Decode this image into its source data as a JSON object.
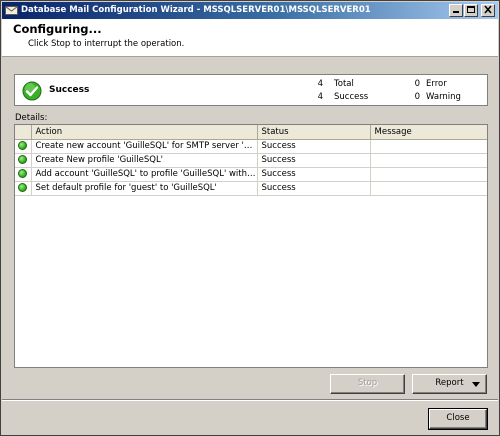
{
  "window": {
    "title": "Database Mail Configuration Wizard - MSSQLSERVER01\\MSSQLSERVER01"
  },
  "header": {
    "heading": "Configuring...",
    "subtitle": "Click Stop to interrupt the operation."
  },
  "summary": {
    "status": "Success",
    "total_count": "4",
    "total_label": "Total",
    "success_count": "4",
    "success_label": "Success",
    "error_count": "0",
    "error_label": "Error",
    "warning_count": "0",
    "warning_label": "Warning"
  },
  "details": {
    "label": "Details:",
    "columns": {
      "action": "Action",
      "status": "Status",
      "message": "Message"
    },
    "rows": [
      {
        "action": "Create new account 'GuilleSQL' for SMTP server 'MSSQL...",
        "status": "Success",
        "message": ""
      },
      {
        "action": "Create New profile 'GuilleSQL'",
        "status": "Success",
        "message": ""
      },
      {
        "action": "Add account 'GuilleSQL' to profile 'GuilleSQL' with priority '1'",
        "status": "Success",
        "message": ""
      },
      {
        "action": "Set default profile for 'guest' to 'GuilleSQL'",
        "status": "Success",
        "message": ""
      }
    ]
  },
  "buttons": {
    "stop": "Stop",
    "report": "Report",
    "close": "Close"
  },
  "icons": {
    "status": "success-check-icon",
    "row": "success-dot-icon"
  }
}
